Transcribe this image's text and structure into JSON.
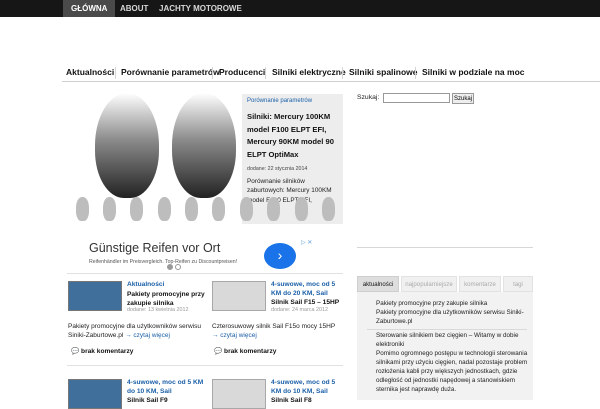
{
  "topnav": [
    {
      "label": "GŁÓWNA",
      "active": true
    },
    {
      "label": "ABOUT",
      "active": false
    },
    {
      "label": "JACHTY MOTOROWE",
      "active": false
    }
  ],
  "catnav": [
    "Aktualności",
    "Porównanie parametrów",
    "Producenci",
    "Silniki elektryczne",
    "Silniki spalinowe",
    "Silniki w podziale na moc"
  ],
  "featured": {
    "category": "Porównanie parametrów",
    "title": "Silniki: Mercury 100KM model F100 ELPT EFI, Mercury 90KM model 90 ELPT OptiMax",
    "date": "dodane: 22 stycznia 2014",
    "excerpt": "Porównanie silników zaburtowych: Mercury 100KM model F100 ELPT EFI,"
  },
  "ad": {
    "headline": "Günstige Reifen vor Ort",
    "subline": "Reifenhändler im Preisvergleich. Top-Reifen zu Discountpreisen!",
    "adchoices": "▷ ✕",
    "arrow": "›"
  },
  "posts": [
    {
      "category": "Aktualności",
      "title": "Pakiety promocyjne przy zakupie silnika",
      "date": "dodane: 13 kwietnia 2012",
      "excerpt": "Pakiety promocyjne dla użytkowników serwisu Siniki-Zaburtowe.pl",
      "more": "→ czytaj więcej",
      "comments": "brak komentarzy",
      "image": "blue"
    },
    {
      "category": "4-suwowe, moc od 5 KM do 20 KM, Sail",
      "title": "Silnik Sail F15 – 15HP",
      "date": "dodane: 24 marca 2012",
      "excerpt": "Czterosuwowy silnik Sail F15o mocy 15HP",
      "more": "→ czytaj więcej",
      "comments": "brak komentarzy",
      "image": "gray"
    },
    {
      "category": "4-suwowe, moc od 5 KM do 10 KM, Sail",
      "title": "Silnik Sail F9",
      "image": "blue"
    },
    {
      "category": "4-suwowe, moc od 5 KM do 10 KM, Sail",
      "title": "Silnik Sail F8",
      "image": "gray"
    }
  ],
  "search": {
    "label": "Szukaj:",
    "placeholder": "",
    "button": "Szukaj"
  },
  "sidebar_tabs": [
    {
      "label": "aktualności",
      "active": true
    },
    {
      "label": "najpopularniejsze",
      "active": false
    },
    {
      "label": "komentarze",
      "active": false
    },
    {
      "label": "tagi",
      "active": false
    }
  ],
  "sidebar_items": [
    "Pakiety promocyjne przy zakupie silnika",
    "Pakiety promocyjne dla użytkowników serwisu Siniki-Zaburtowe.pl",
    "Sterowanie silnikiem bez cięgien – Witamy w dobie elektroniki",
    "Pomimo ogromnego postępu w technologii sterowania silnikami przy użyciu cięgien, nadal pozostaje problem rozłożenia kabli przy większych jednostkach, gdzie odległość od jednostki napędowej a stanowiskiem sternika jest naprawdę duża."
  ],
  "colors": {
    "topbar": "#161616",
    "link": "#1a5fa8",
    "tabpanel": "#f2f2f2"
  }
}
